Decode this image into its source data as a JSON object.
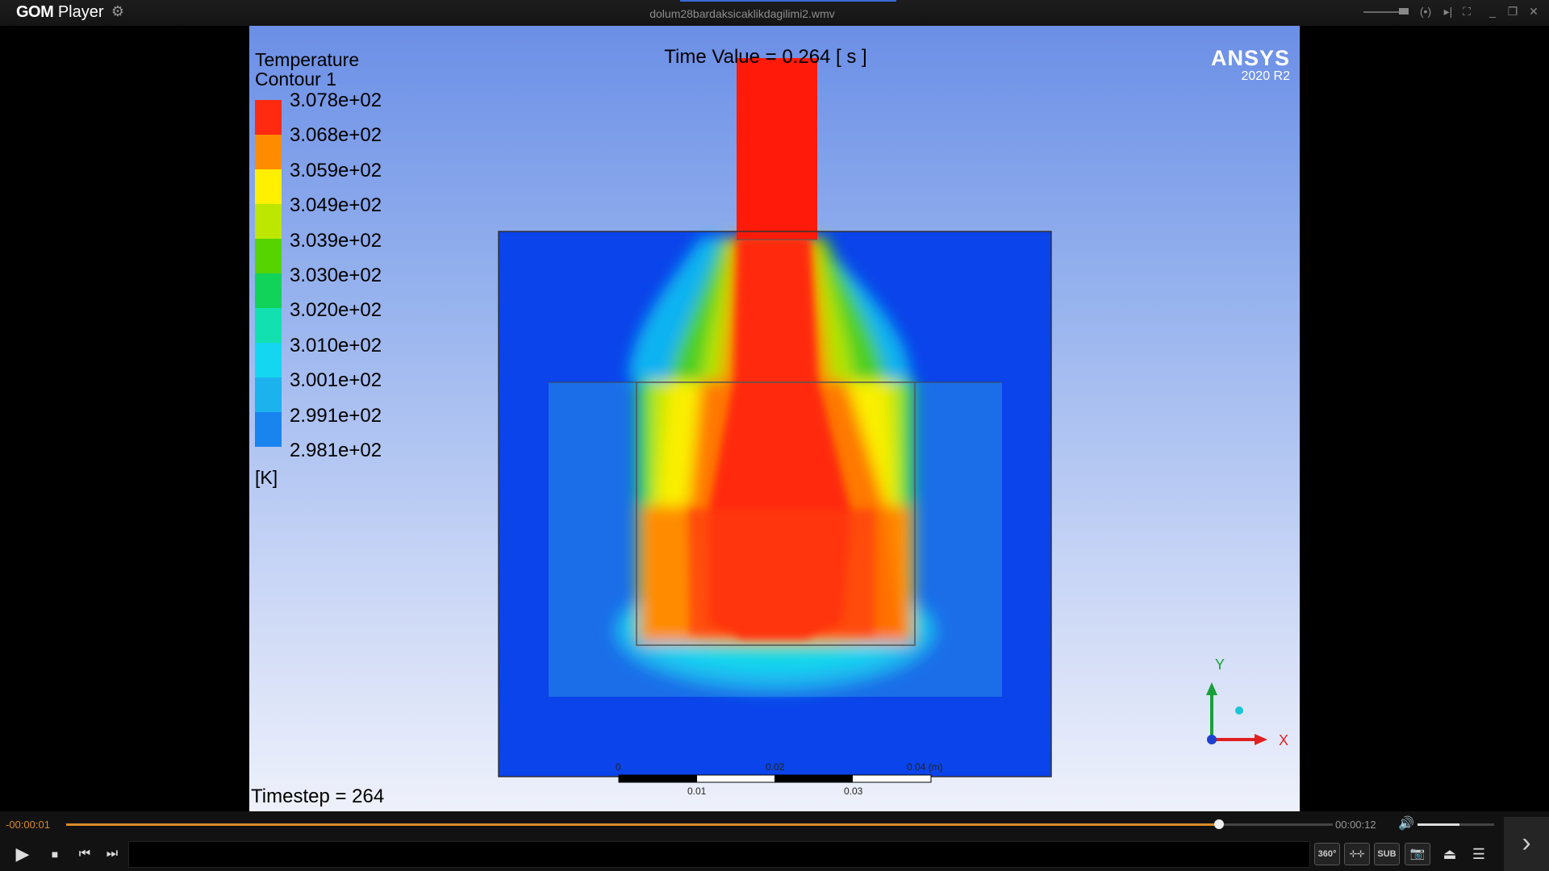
{
  "app": {
    "name_brand": "GOM",
    "name_rest": " Player",
    "filename": "dolum28bardaksicaklikdagilimi2.wmv"
  },
  "video": {
    "legend": {
      "title_line1": "Temperature",
      "title_line2": "Contour 1",
      "values": [
        "3.078e+02",
        "3.068e+02",
        "3.059e+02",
        "3.049e+02",
        "3.039e+02",
        "3.030e+02",
        "3.020e+02",
        "3.010e+02",
        "3.001e+02",
        "2.991e+02",
        "2.981e+02"
      ],
      "unit": "[K]",
      "colors": [
        "#ff2a0f",
        "#ff8c00",
        "#ffef00",
        "#bde600",
        "#55d400",
        "#12d35a",
        "#13e0b0",
        "#15d6f0",
        "#1bb2ee",
        "#1a84ee",
        "#0a44ea"
      ]
    },
    "time_value": "Time Value = 0.264 [ s ]",
    "brand": "ANSYS",
    "version": "2020 R2",
    "timestep": "Timestep = 264",
    "scale_bar": {
      "upper": [
        "0",
        "0.02",
        "0.04 (m)"
      ],
      "lower": [
        "0.01",
        "0.03"
      ]
    },
    "axes": {
      "x": "X",
      "y": "Y"
    }
  },
  "controls": {
    "current_time": "-00:00:01",
    "total_time": "00:00:12",
    "progress": 0.91,
    "volume": 0.55,
    "sub_label": "SUB",
    "vr_label": "360°"
  }
}
